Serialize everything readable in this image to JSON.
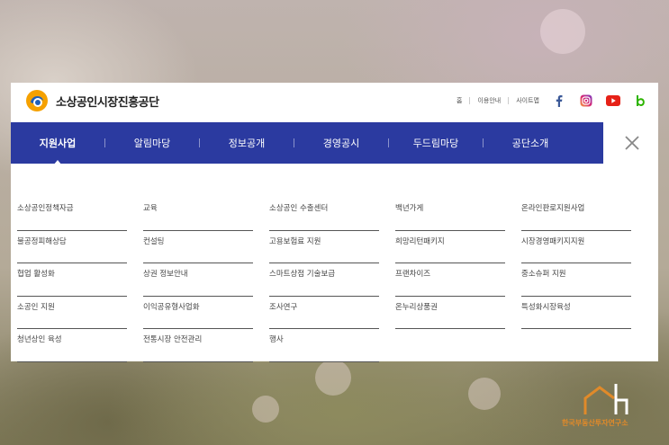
{
  "header": {
    "org_name": "소상공인시장진흥공단",
    "util_links": [
      "홈",
      "이용안내",
      "사이트맵"
    ],
    "sns_icons": [
      "facebook-icon",
      "instagram-icon",
      "youtube-icon",
      "blog-icon"
    ]
  },
  "gnb": {
    "items": [
      "지원사업",
      "알림마당",
      "정보공개",
      "경영공시",
      "두드림마당",
      "공단소개"
    ],
    "active": "지원사업"
  },
  "submenu": {
    "columns": [
      [
        "소상공인정책자금",
        "불공정피해상담",
        "협업 활성화",
        "소공인 지원",
        "청년상인 육성"
      ],
      [
        "교육",
        "컨설팅",
        "상권 정보안내",
        "이익공유형사업화",
        "전통시장 안전관리"
      ],
      [
        "소상공인 수출센터",
        "고용보험료 지원",
        "스마트상점 기술보급",
        "조사연구",
        "행사"
      ],
      [
        "백년가게",
        "희망리턴패키지",
        "프랜차이즈",
        "온누리상품권"
      ],
      [
        "온라인판로지원사업",
        "시장경영패키지지원",
        "중소슈퍼 지원",
        "특성화시장육성"
      ]
    ]
  },
  "watermark": {
    "text": "한국부동산투자연구소"
  },
  "colors": {
    "gnb_bg": "#2b3aa0",
    "logo_orange": "#f5a100",
    "logo_blue": "#1f5fb8",
    "watermark": "#e08a2a"
  }
}
